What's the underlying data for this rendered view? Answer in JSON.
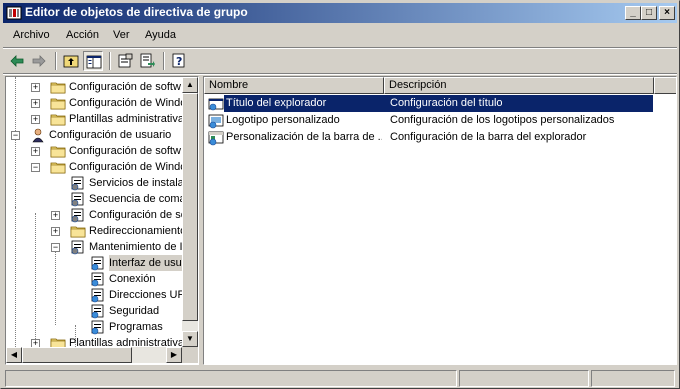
{
  "window": {
    "title": "Editor de objetos de directiva de grupo"
  },
  "titlebar": {
    "minimize": "_",
    "maximize": "□",
    "close": "×"
  },
  "menu": [
    "Archivo",
    "Acción",
    "Ver",
    "Ayuda"
  ],
  "toolbar": {
    "buttons": [
      "back-icon",
      "forward-icon",
      "up-folder-icon",
      "show-hide-tree-icon",
      "properties-icon",
      "export-list-icon",
      "help-icon"
    ]
  },
  "tree": {
    "items": [
      {
        "label": "Configuración de softw",
        "level": 1,
        "expander": "+"
      },
      {
        "label": "Configuración de Windc",
        "level": 1,
        "expander": "+"
      },
      {
        "label": "Plantillas administrativa",
        "level": 1,
        "expander": "+"
      },
      {
        "label": "Configuración de usuario",
        "level": 0,
        "expander": "−"
      },
      {
        "label": "Configuración de softw",
        "level": 1,
        "expander": "+"
      },
      {
        "label": "Configuración de Windc",
        "level": 1,
        "expander": "−"
      },
      {
        "label": "Servicios de instalac",
        "level": 2,
        "expander": ""
      },
      {
        "label": "Secuencia de comar",
        "level": 2,
        "expander": ""
      },
      {
        "label": "Configuración de se",
        "level": 2,
        "expander": "+"
      },
      {
        "label": "Redireccionamiento",
        "level": 2,
        "expander": "+"
      },
      {
        "label": "Mantenimiento de Ir",
        "level": 2,
        "expander": "−"
      },
      {
        "label": "Interfaz de usu",
        "level": 3,
        "expander": ""
      },
      {
        "label": "Conexión",
        "level": 3,
        "expander": ""
      },
      {
        "label": "Direcciones URL",
        "level": 3,
        "expander": ""
      },
      {
        "label": "Seguridad",
        "level": 3,
        "expander": ""
      },
      {
        "label": "Programas",
        "level": 3,
        "expander": ""
      },
      {
        "label": "Plantillas administrativa:",
        "level": 1,
        "expander": "+"
      }
    ]
  },
  "list": {
    "columns": [
      "Nombre",
      "Descripción"
    ],
    "rows": [
      {
        "name": "Título del explorador",
        "description": "Configuración del título",
        "selected": true
      },
      {
        "name": "Logotipo personalizado",
        "description": "Configuración de los logotipos personalizados",
        "selected": false
      },
      {
        "name": "Personalización de la barra de ...",
        "description": "Configuración de la barra del explorador",
        "selected": false
      }
    ]
  },
  "colors": {
    "selection": "#0a246a",
    "face": "#d4d0c8",
    "title_gradient_end": "#a6caf0"
  }
}
